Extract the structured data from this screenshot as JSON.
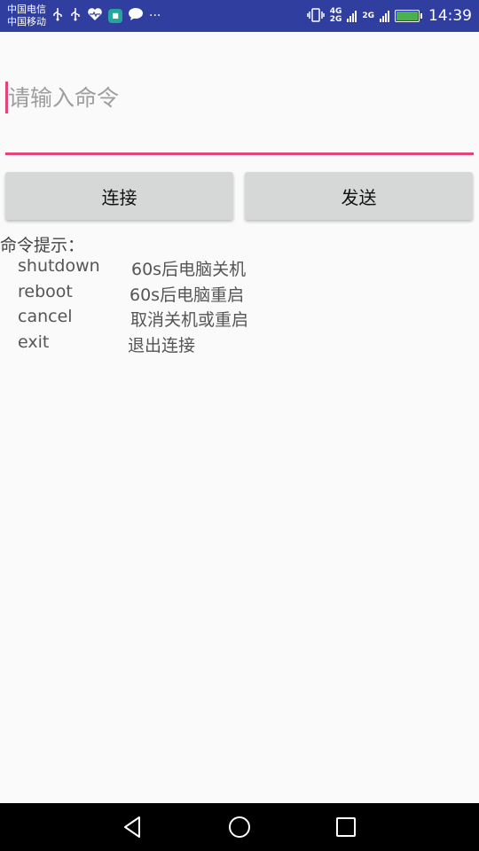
{
  "status_bar": {
    "carrier_1": "中国电信",
    "carrier_2": "中国移动",
    "net_top": "4G",
    "net_bottom": "2G",
    "net_2": "2G",
    "time": "14:39",
    "more": "···",
    "app_icon_text": "■"
  },
  "command": {
    "placeholder": "请输入命令",
    "value": ""
  },
  "buttons": {
    "connect_label": "连接",
    "send_label": "发送"
  },
  "hints": {
    "title": "命令提示：",
    "items": [
      {
        "command": "shutdown",
        "description": "60s后电脑关机"
      },
      {
        "command": "reboot",
        "description": "60s后电脑重启"
      },
      {
        "command": "cancel",
        "description": "取消关机或重启"
      },
      {
        "command": "exit",
        "description": "退出连接"
      }
    ]
  },
  "colors": {
    "accent": "#e0457b",
    "status_bar": "#303f9f",
    "button": "#d6d7d7"
  }
}
